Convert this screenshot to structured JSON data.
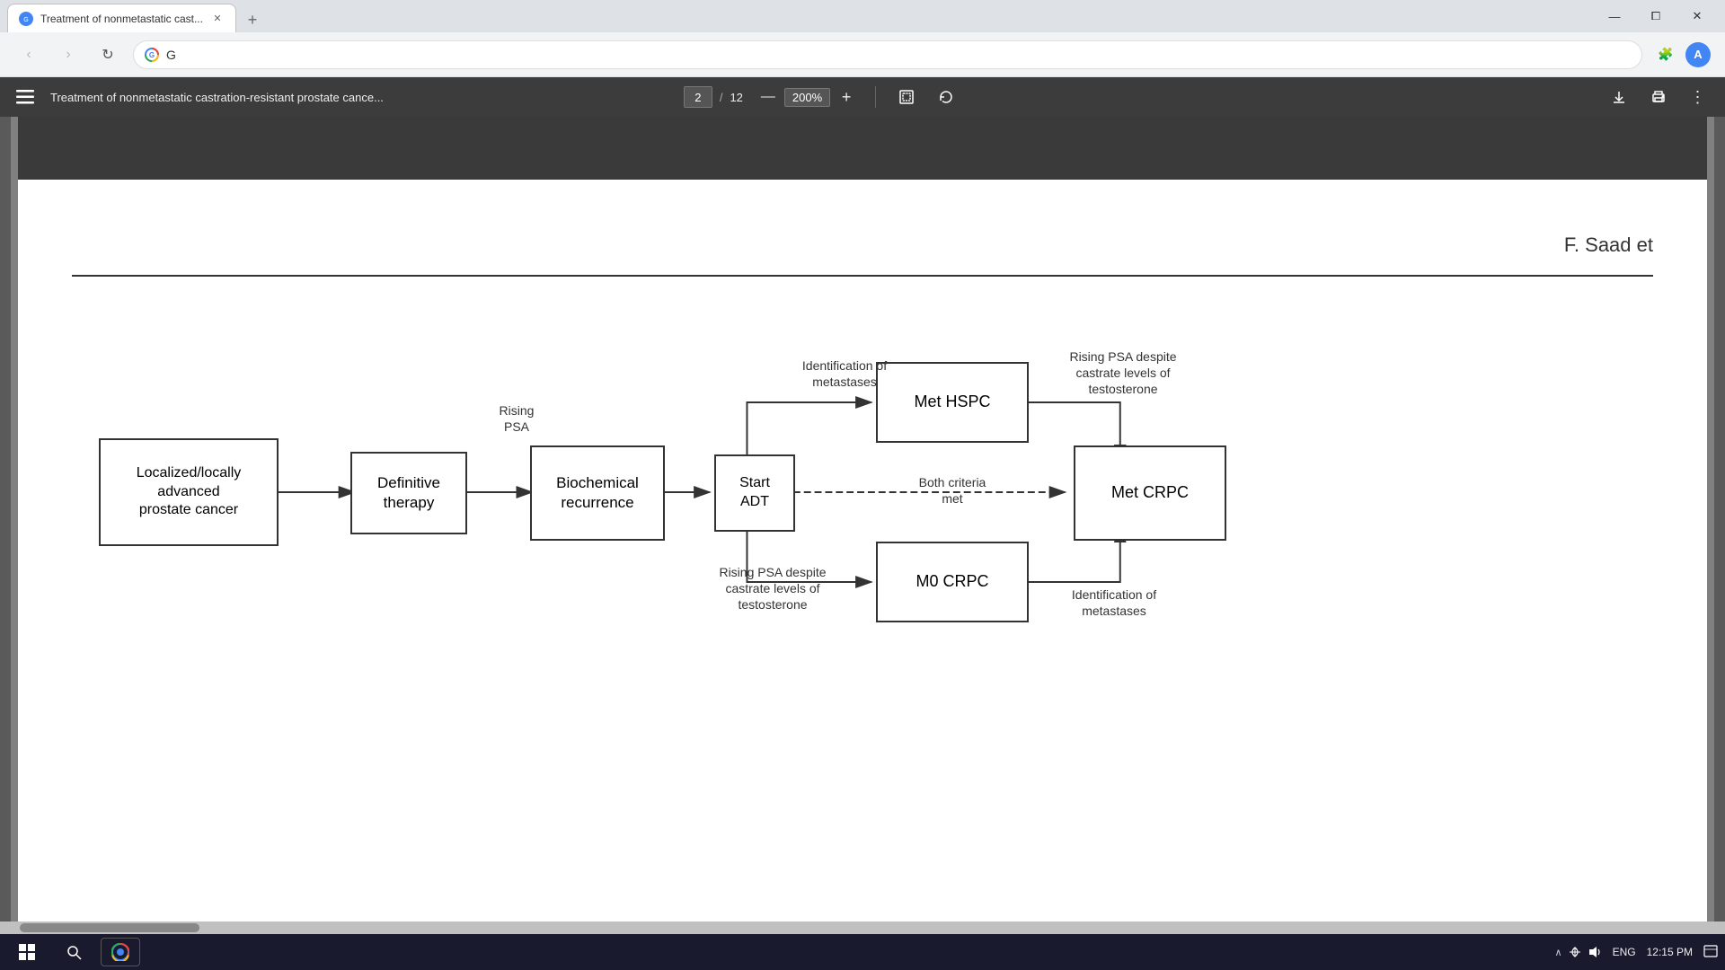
{
  "browser": {
    "tab": {
      "label": "Treatment of nonmetastatic cast...",
      "favicon": "G"
    },
    "window_controls": {
      "minimize": "—",
      "maximize": "⧠",
      "close": "✕"
    },
    "address_bar": {
      "url": "G",
      "back": "‹",
      "forward": "›",
      "reload": "↻"
    }
  },
  "pdf": {
    "toolbar": {
      "menu_icon": "☰",
      "title": "Treatment of nonmetastatic castration-resistant prostate cance...",
      "page_current": "2",
      "page_sep": "/",
      "page_total": "12",
      "zoom_minus": "—",
      "zoom_value": "200%",
      "zoom_plus": "+",
      "fit_icon": "⊡",
      "rotate_icon": "↺",
      "download_icon": "⬇",
      "print_icon": "🖶",
      "more_icon": "⋮"
    },
    "content": {
      "author": "F. Saad et",
      "boxes": [
        {
          "id": "localized",
          "text": "Localized/locally\nadvanced\nprostate cancer"
        },
        {
          "id": "definitive",
          "text": "Definitive\ntherapy"
        },
        {
          "id": "biochemical",
          "text": "Biochemical\nrecurrence"
        },
        {
          "id": "start_adt",
          "text": "Start\nADT"
        },
        {
          "id": "met_hspc",
          "text": "Met HSPC"
        },
        {
          "id": "met_crpc",
          "text": "Met CRPC"
        },
        {
          "id": "m0_crpc",
          "text": "M0 CRPC"
        }
      ],
      "labels": [
        {
          "id": "rising_psa_1",
          "text": "Rising\nPSA"
        },
        {
          "id": "identification_metastases",
          "text": "Identification of\nmetastases"
        },
        {
          "id": "rising_psa_top",
          "text": "Rising PSA despite\ncastrate levels of\ntestosterone"
        },
        {
          "id": "both_criteria",
          "text": "Both criteria\nmet"
        },
        {
          "id": "rising_psa_bottom",
          "text": "Rising PSA despite\ncastrate levels of\ntestosterone"
        },
        {
          "id": "identification_metastases_2",
          "text": "Identification of\nmetastases"
        }
      ]
    }
  },
  "taskbar": {
    "time": "12:15 PM",
    "lang": "ENG",
    "start_icon": "⊞",
    "search_icon": "🔍"
  }
}
